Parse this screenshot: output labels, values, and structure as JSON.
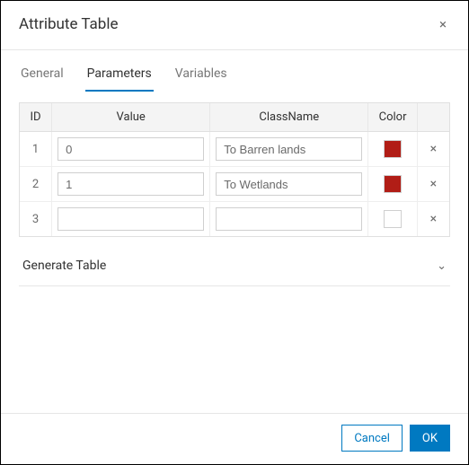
{
  "dialog": {
    "title": "Attribute Table",
    "close_icon": "×"
  },
  "tabs": {
    "items": [
      {
        "label": "General",
        "active": false
      },
      {
        "label": "Parameters",
        "active": true
      },
      {
        "label": "Variables",
        "active": false
      }
    ]
  },
  "table": {
    "headers": {
      "id": "ID",
      "value": "Value",
      "class_name": "ClassName",
      "color": "Color",
      "delete": ""
    },
    "rows": [
      {
        "id": "1",
        "value": "0",
        "class_name": "To Barren lands",
        "color": "#b11d16"
      },
      {
        "id": "2",
        "value": "1",
        "class_name": "To Wetlands",
        "color": "#b11d16"
      },
      {
        "id": "3",
        "value": "",
        "class_name": "",
        "color": "#ffffff"
      }
    ],
    "delete_icon": "×"
  },
  "generate": {
    "label": "Generate Table",
    "chevron": "⌄"
  },
  "footer": {
    "cancel": "Cancel",
    "ok": "OK"
  }
}
